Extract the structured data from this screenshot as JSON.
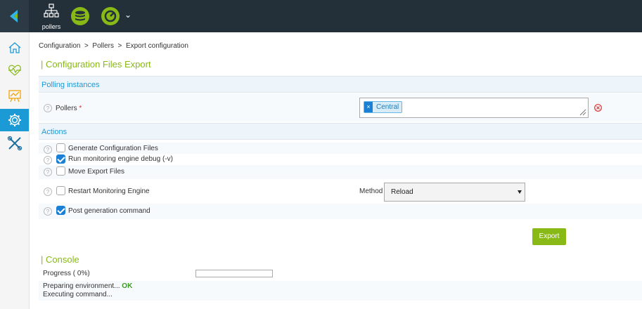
{
  "topbar": {
    "poller_label": "pollers"
  },
  "sidebar": {
    "items": [
      "home-icon",
      "monitoring-icon",
      "reporting-icon",
      "configuration-icon",
      "administration-icon"
    ],
    "active": "configuration-icon"
  },
  "breadcrumb": "Configuration  >  Pollers  >  Export configuration",
  "page_title": "| Configuration Files Export",
  "polling_section": {
    "title": "Polling instances",
    "pollers_label": "Pollers",
    "required_mark": "*",
    "selected_tag": "Central",
    "tag_remove": "×"
  },
  "actions_section": {
    "title": "Actions",
    "options": [
      {
        "label": "Generate Configuration Files",
        "checked": false
      },
      {
        "label": "Run monitoring engine debug (-v)",
        "checked": true
      },
      {
        "label": "Move Export Files",
        "checked": false
      },
      {
        "label": "Restart Monitoring Engine",
        "checked": false
      },
      {
        "label": "Post generation command",
        "checked": true
      }
    ],
    "method_label": "Method",
    "method_value": "Reload"
  },
  "export_button": "Export",
  "console": {
    "title": "| Console",
    "progress_label": "Progress ( 0%)",
    "progress": 0,
    "log_line1": "Preparing environment...",
    "log_line1_status": "OK",
    "log_line2": "Executing command..."
  },
  "colors": {
    "accent_green": "#88b917",
    "accent_blue": "#1e9ad6",
    "topbar": "#232f39"
  }
}
